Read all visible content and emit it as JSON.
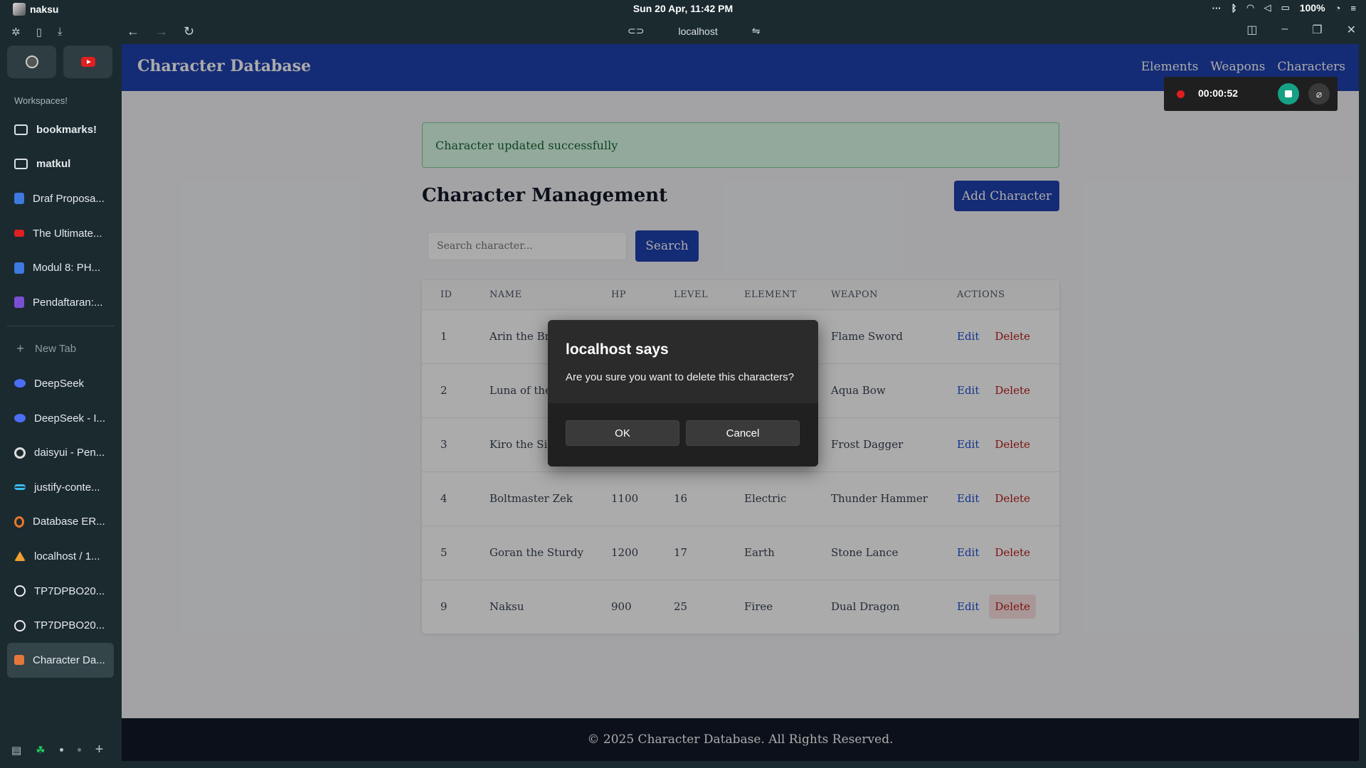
{
  "os": {
    "user": "naksu",
    "clock": "Sun 20 Apr, 11:42 PM",
    "battery": "100%",
    "tray_more": "···"
  },
  "sidebar": {
    "workspaces_label": "Workspaces!",
    "items": [
      {
        "label": "bookmarks!",
        "icon": "folder-icon"
      },
      {
        "label": "matkul",
        "icon": "folder-icon"
      },
      {
        "label": "Draf Proposa...",
        "icon": "google-docs-icon"
      },
      {
        "label": "The Ultimate...",
        "icon": "youtube-icon"
      },
      {
        "label": "Modul 8: PH...",
        "icon": "google-docs-icon"
      },
      {
        "label": "Pendaftaran:...",
        "icon": "google-forms-icon"
      }
    ],
    "new_tab": "New Tab",
    "tabs": [
      {
        "label": "DeepSeek",
        "icon": "deepseek-icon"
      },
      {
        "label": "DeepSeek - I...",
        "icon": "deepseek-icon"
      },
      {
        "label": "daisyui - Pen...",
        "icon": "google-icon"
      },
      {
        "label": "justify-conte...",
        "icon": "tailwind-icon"
      },
      {
        "label": "Database ER...",
        "icon": "database-er-icon"
      },
      {
        "label": "localhost / 1...",
        "icon": "phpmyadmin-icon"
      },
      {
        "label": "TP7DPBO20...",
        "icon": "github-icon"
      },
      {
        "label": "TP7DPBO20...",
        "icon": "github-icon"
      },
      {
        "label": "Character Da...",
        "icon": "character-db-icon"
      }
    ]
  },
  "toolbar": {
    "url": "localhost"
  },
  "page": {
    "brand": "Character Database",
    "nav": [
      "Elements",
      "Weapons",
      "Characters"
    ],
    "alert": "Character updated successfully",
    "title": "Character Management",
    "add_button": "Add Character",
    "search_placeholder": "Search character...",
    "search_button": "Search",
    "columns": [
      "ID",
      "NAME",
      "HP",
      "LEVEL",
      "ELEMENT",
      "WEAPON",
      "ACTIONS"
    ],
    "edit_label": "Edit",
    "delete_label": "Delete",
    "rows": [
      {
        "id": "1",
        "name": "Arin the Bra",
        "hp": "",
        "level": "",
        "element": "",
        "weapon": "Flame Sword"
      },
      {
        "id": "2",
        "name": "Luna of the",
        "hp": "",
        "level": "",
        "element": "",
        "weapon": "Aqua Bow"
      },
      {
        "id": "3",
        "name": "Kiro the Sile",
        "hp": "",
        "level": "",
        "element": "",
        "weapon": "Frost Dagger"
      },
      {
        "id": "4",
        "name": "Boltmaster Zek",
        "hp": "1100",
        "level": "16",
        "element": "Electric",
        "weapon": "Thunder Hammer"
      },
      {
        "id": "5",
        "name": "Goran the Sturdy",
        "hp": "1200",
        "level": "17",
        "element": "Earth",
        "weapon": "Stone Lance"
      },
      {
        "id": "9",
        "name": "Naksu",
        "hp": "900",
        "level": "25",
        "element": "Firee",
        "weapon": "Dual Dragon"
      }
    ],
    "footer": "© 2025 Character Database. All Rights Reserved."
  },
  "recorder": {
    "time": "00:00:52"
  },
  "dialog": {
    "title": "localhost says",
    "message": "Are you sure you want to delete this characters?",
    "ok": "OK",
    "cancel": "Cancel"
  }
}
